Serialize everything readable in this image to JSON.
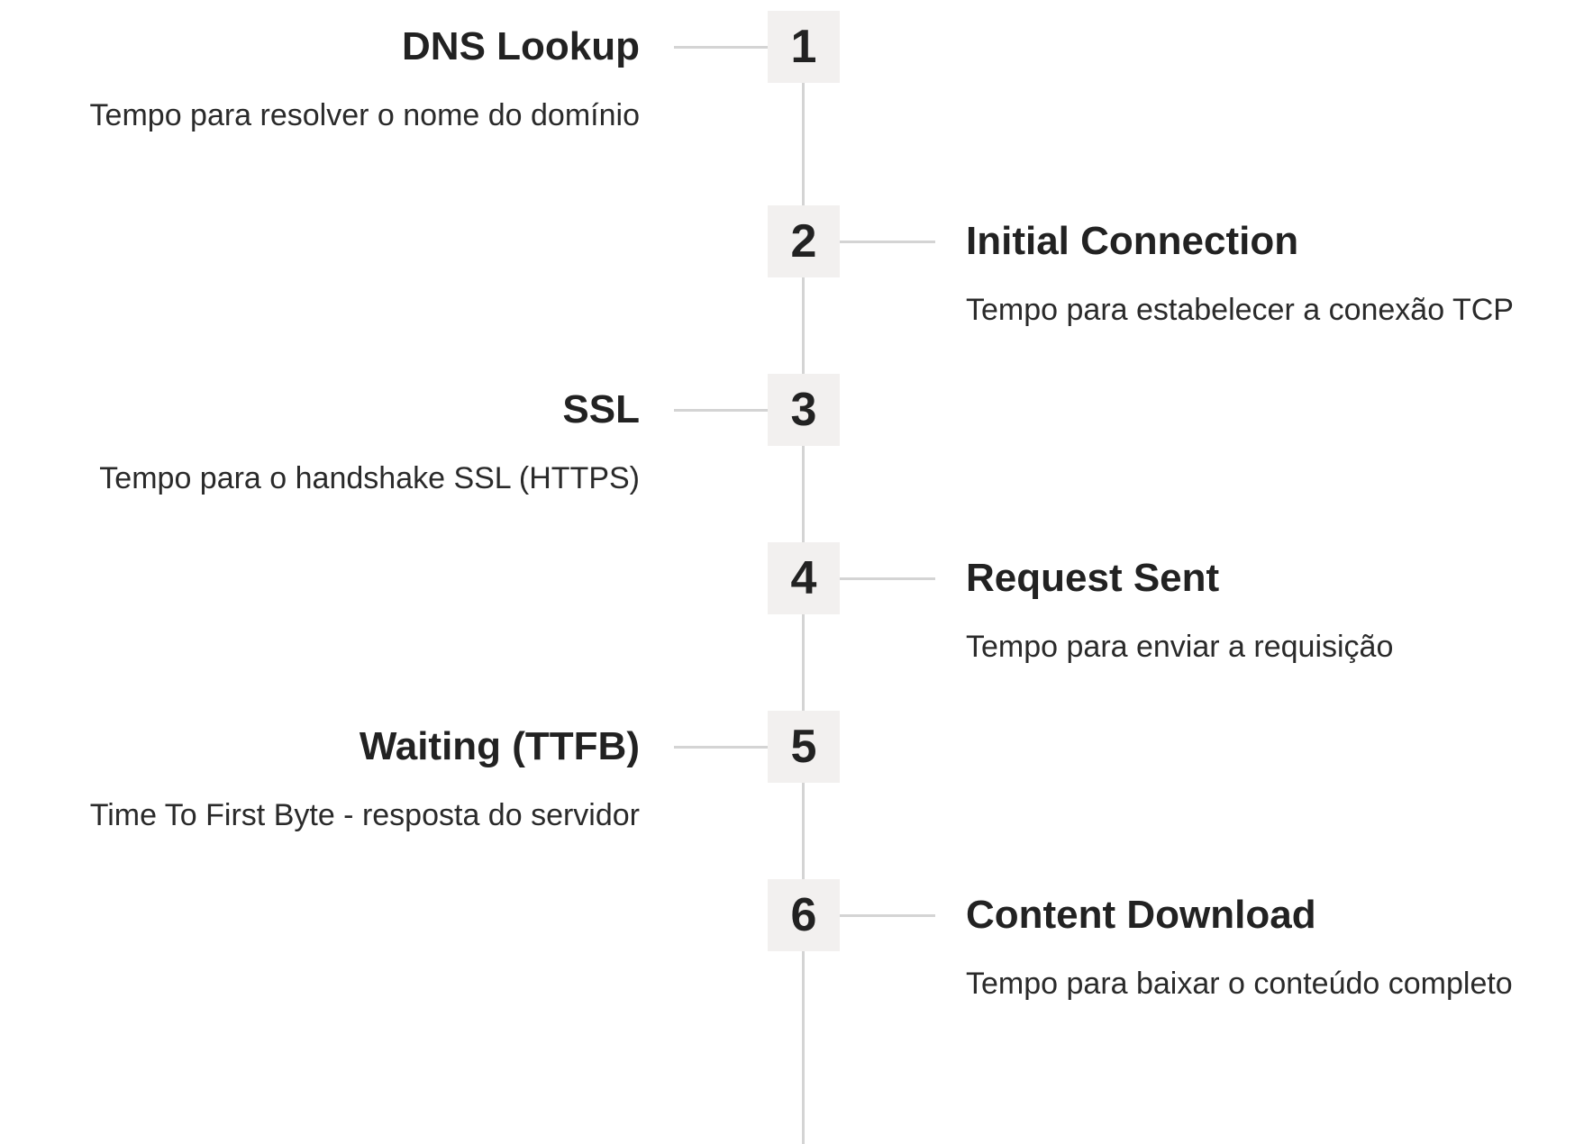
{
  "steps": [
    {
      "number": "1",
      "title": "DNS Lookup",
      "description": "Tempo para resolver o nome do domínio",
      "side": "left"
    },
    {
      "number": "2",
      "title": "Initial Connection",
      "description": "Tempo para estabelecer a conexão TCP",
      "side": "right"
    },
    {
      "number": "3",
      "title": "SSL",
      "description": "Tempo para o handshake SSL (HTTPS)",
      "side": "left"
    },
    {
      "number": "4",
      "title": "Request Sent",
      "description": "Tempo para enviar a requisição",
      "side": "right"
    },
    {
      "number": "5",
      "title": "Waiting (TTFB)",
      "description": "Time To First Byte - resposta do servidor",
      "side": "left"
    },
    {
      "number": "6",
      "title": "Content Download",
      "description": "Tempo para baixar o conteúdo completo",
      "side": "right"
    }
  ]
}
